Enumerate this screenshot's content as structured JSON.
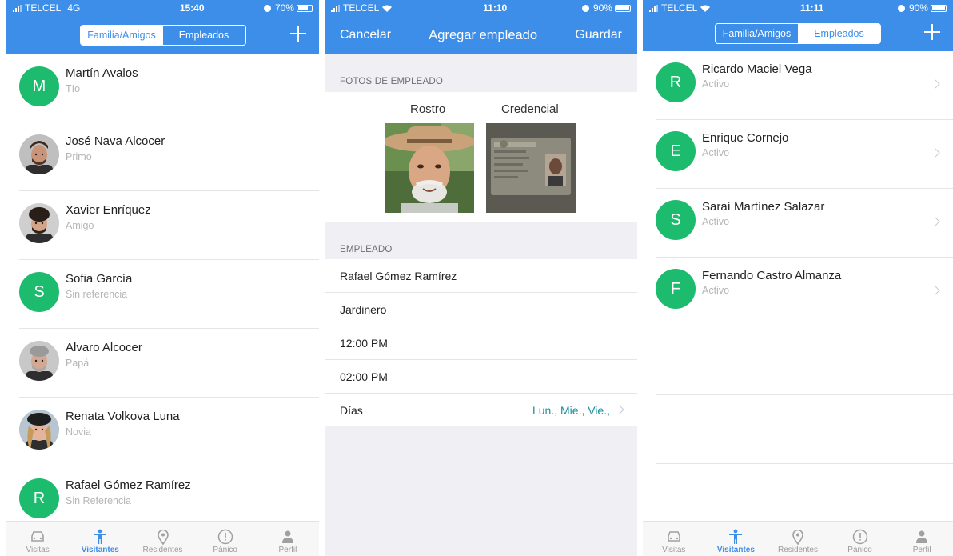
{
  "colors": {
    "brand": "#3d8ee8",
    "initial_avatar": "#1dbb6e",
    "link_teal": "#1b8f9e"
  },
  "p1": {
    "status": {
      "carrier": "TELCEL",
      "network": "4G",
      "time": "15:40",
      "battery": "70%"
    },
    "segment": {
      "a": "Familia/Amigos",
      "b": "Empleados",
      "selected": "a"
    },
    "contacts": [
      {
        "name": "Martín Avalos",
        "sub": "Tío",
        "initial": "M"
      },
      {
        "name": "José Nava Alcocer",
        "sub": "Primo",
        "photo": "man-short-hair"
      },
      {
        "name": "Xavier Enríquez",
        "sub": "Amigo",
        "photo": "man-curly-hair"
      },
      {
        "name": "Sofia García",
        "sub": "Sin referencia",
        "initial": "S"
      },
      {
        "name": "Alvaro Alcocer",
        "sub": "Papá",
        "photo": "man-gray-hair"
      },
      {
        "name": "Renata Volkova Luna",
        "sub": "Novia",
        "photo": "woman-hat"
      },
      {
        "name": "Rafael Gómez Ramírez",
        "sub": "Sin Referencia",
        "initial": "R"
      }
    ]
  },
  "p2": {
    "status": {
      "carrier": "TELCEL",
      "time": "11:10",
      "battery": "90%"
    },
    "cancel": "Cancelar",
    "title": "Agregar empleado",
    "save": "Guardar",
    "photos_header": "FOTOS DE EMPLEADO",
    "rostro": "Rostro",
    "credencial": "Credencial",
    "employee_header": "EMPLEADO",
    "fields": [
      "Rafael Gómez Ramírez",
      "Jardinero",
      "12:00 PM",
      "02:00 PM"
    ],
    "dias_label": "Días",
    "dias_value": "Lun., Mie., Vie.,"
  },
  "p3": {
    "status": {
      "carrier": "TELCEL",
      "time": "11:11",
      "battery": "90%"
    },
    "segment": {
      "a": "Familia/Amigos",
      "b": "Empleados",
      "selected": "b"
    },
    "employees": [
      {
        "name": "Ricardo Maciel Vega",
        "status": "Activo",
        "initial": "R"
      },
      {
        "name": "Enrique Cornejo",
        "status": "Activo",
        "initial": "E"
      },
      {
        "name": "Saraí Martínez Salazar",
        "status": "Activo",
        "initial": "S"
      },
      {
        "name": "Fernando Castro Almanza",
        "status": "Activo",
        "initial": "F"
      }
    ]
  },
  "tabs": [
    {
      "label": "Visitas",
      "icon": "car-icon"
    },
    {
      "label": "Visitantes",
      "icon": "person-icon",
      "active": true
    },
    {
      "label": "Residentes",
      "icon": "location-pin-icon"
    },
    {
      "label": "Pánico",
      "icon": "alert-icon"
    },
    {
      "label": "Perfil",
      "icon": "profile-icon"
    }
  ]
}
